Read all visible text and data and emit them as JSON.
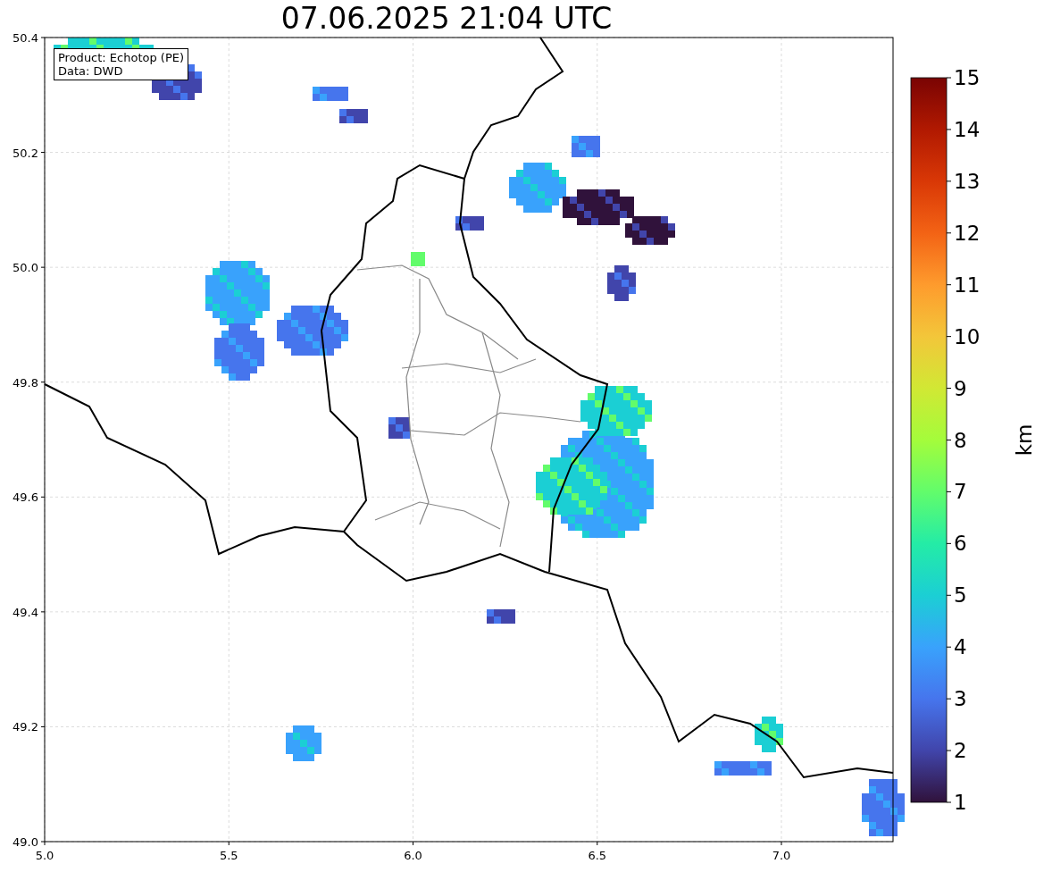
{
  "title": "07.06.2025 21:04 UTC",
  "legend": [
    "Product: Echotop (PE)",
    "Data: DWD"
  ],
  "plot": {
    "xticks": [
      "5.0",
      "5.5",
      "6.0",
      "6.5",
      "7.0"
    ],
    "yticks": [
      "50.4",
      "50.2",
      "50.0",
      "49.8",
      "49.6",
      "49.4",
      "49.2",
      "49.0"
    ]
  },
  "colorbar": {
    "ticks": [
      "15",
      "14",
      "13",
      "12",
      "11",
      "10",
      "9",
      "8",
      "7",
      "6",
      "5",
      "4",
      "3",
      "2",
      "1"
    ],
    "label": "km"
  }
}
